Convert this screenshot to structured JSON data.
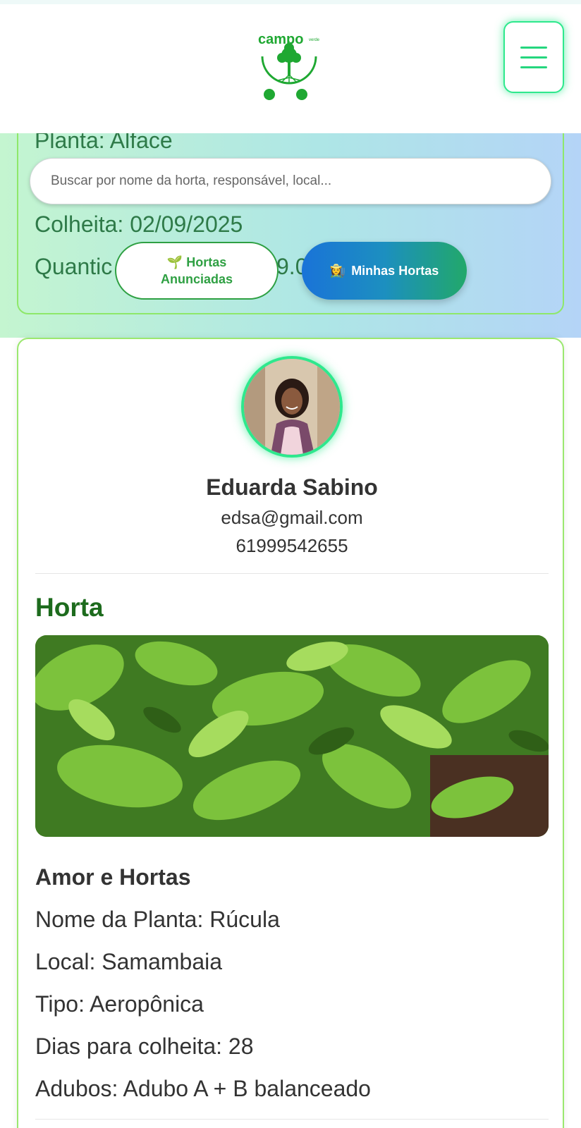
{
  "header": {
    "logo_text": "campo",
    "logo_small_text": "verde",
    "menu_icon": "hamburger-icon"
  },
  "previous_card": {
    "plant": "Planta: Alface",
    "harvest": "Colheita: 02/09/2025",
    "quantity_left": "Quantic",
    "quantity_right": "9.0"
  },
  "search": {
    "placeholder": "Buscar por nome da horta, responsável, local..."
  },
  "buttons": {
    "hortas_icon": "🌱",
    "hortas_line1": "Hortas",
    "hortas_line2": "Anunciadas",
    "minhas_icon": "👩‍🌾",
    "minhas_label": "Minhas Hortas"
  },
  "profile": {
    "name": "Eduarda Sabino",
    "email": "edsa@gmail.com",
    "phone": "61999542655"
  },
  "horta": {
    "section_title": "Horta",
    "garden_name": "Amor e Hortas",
    "plant_name": "Nome da Planta: Rúcula",
    "location": "Local: Samambaia",
    "type": "Tipo: Aeropônica",
    "days_to_harvest": "Dias para colheita: 28",
    "fertilizers": "Adubos: Adubo A + B balanceado"
  },
  "colors": {
    "accent": "#2ee88d",
    "brand_green": "#1fa832",
    "title_green": "#1d6b1d"
  }
}
